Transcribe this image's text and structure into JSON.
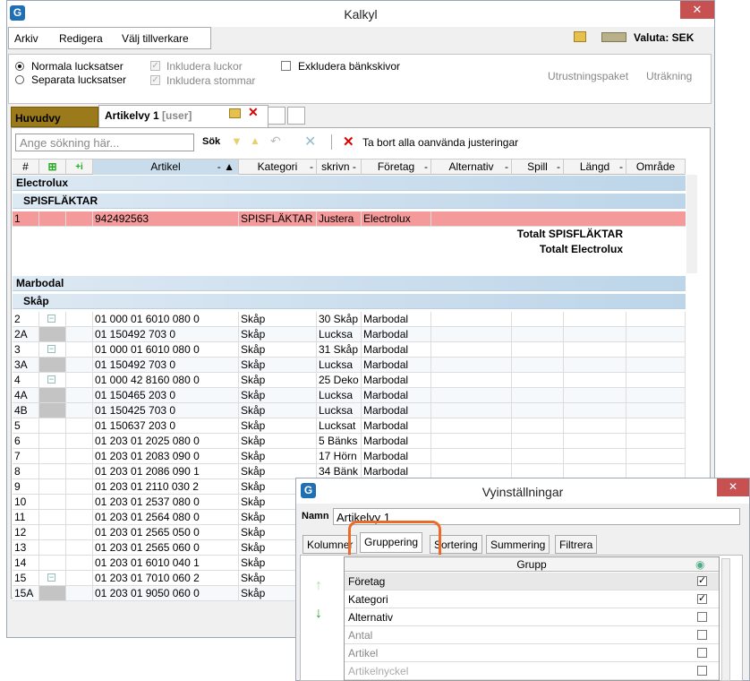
{
  "window": {
    "title": "Kalkyl",
    "close": "✕"
  },
  "menu": {
    "items": [
      "Arkiv",
      "Redigera",
      "Välj tillverkare"
    ],
    "valuta": "Valuta: SEK"
  },
  "options": {
    "normal": "Normala lucksatser",
    "separate": "Separata lucksatser",
    "incl_doors": "Inkludera luckor",
    "incl_frames": "Inkludera stommar",
    "excl_bench": "Exkludera bänkskivor",
    "equip": "Utrustningspaket",
    "calc": "Uträkning"
  },
  "tabs": {
    "main": "Huvudvy",
    "view": "Artikelvy 1",
    "view_user": "[user]"
  },
  "toolbar": {
    "search_placeholder": "Ange sökning här...",
    "search_btn": "Sök",
    "remove_unused": "Ta bort alla oanvända justeringar"
  },
  "columns": [
    "#",
    "",
    "",
    "Artikel",
    "Kategori",
    "skrivn",
    "Företag",
    "Alternativ",
    "Spill",
    "Längd",
    "Område"
  ],
  "groups": {
    "electrolux": "Electrolux",
    "spisflaktar": "SPISFLÄKTAR",
    "total_spis": "Totalt SPISFLÄKTAR",
    "total_electrolux": "Totalt Electrolux",
    "marbodal": "Marbodal",
    "skap": "Skåp"
  },
  "rows": [
    {
      "n": "2",
      "art": "01 000 01 6010 080 0",
      "kat": "Skåp",
      "desc": "30 Skåp",
      "fo": "Marbodal"
    },
    {
      "n": "2A",
      "art": "01 150492 703 0",
      "kat": "Skåp",
      "desc": "Lucksa",
      "fo": "Marbodal"
    },
    {
      "n": "3",
      "art": "01 000 01 6010 080 0",
      "kat": "Skåp",
      "desc": "31 Skåp",
      "fo": "Marbodal"
    },
    {
      "n": "3A",
      "art": "01 150492 703 0",
      "kat": "Skåp",
      "desc": "Lucksa",
      "fo": "Marbodal"
    },
    {
      "n": "4",
      "art": "01 000 42 8160 080 0",
      "kat": "Skåp",
      "desc": "25 Deko",
      "fo": "Marbodal"
    },
    {
      "n": "4A",
      "art": "01 150465 203 0",
      "kat": "Skåp",
      "desc": "Lucksa",
      "fo": "Marbodal"
    },
    {
      "n": "4B",
      "art": "01 150425 703 0",
      "kat": "Skåp",
      "desc": "Lucksa",
      "fo": "Marbodal"
    },
    {
      "n": "5",
      "art": "01 150637 203 0",
      "kat": "Skåp",
      "desc": "Lucksat",
      "fo": "Marbodal"
    },
    {
      "n": "6",
      "art": "01 203 01 2025 080 0",
      "kat": "Skåp",
      "desc": "5 Bänks",
      "fo": "Marbodal"
    },
    {
      "n": "7",
      "art": "01 203 01 2083 090 0",
      "kat": "Skåp",
      "desc": "17 Hörn",
      "fo": "Marbodal"
    },
    {
      "n": "8",
      "art": "01 203 01 2086 090 1",
      "kat": "Skåp",
      "desc": "34 Bänk",
      "fo": "Marbodal"
    },
    {
      "n": "9",
      "art": "01 203 01 2110 030 2",
      "kat": "Skåp",
      "desc": "",
      "fo": ""
    },
    {
      "n": "10",
      "art": "01 203 01 2537 080 0",
      "kat": "Skåp",
      "desc": "",
      "fo": ""
    },
    {
      "n": "11",
      "art": "01 203 01 2564 080 0",
      "kat": "Skåp",
      "desc": "",
      "fo": ""
    },
    {
      "n": "12",
      "art": "01 203 01 2565 050 0",
      "kat": "Skåp",
      "desc": "",
      "fo": ""
    },
    {
      "n": "13",
      "art": "01 203 01 2565 060 0",
      "kat": "Skåp",
      "desc": "",
      "fo": ""
    },
    {
      "n": "14",
      "art": "01 203 01 6010 040 1",
      "kat": "Skåp",
      "desc": "",
      "fo": ""
    },
    {
      "n": "15",
      "art": "01 203 01 7010 060 2",
      "kat": "Skåp",
      "desc": "",
      "fo": ""
    },
    {
      "n": "15A",
      "art": "01 203 01 9050 060 0",
      "kat": "Skåp",
      "desc": "",
      "fo": ""
    }
  ],
  "spis_row": {
    "n": "1",
    "art": "942492563",
    "kat": "SPISFLÄKTAR",
    "desc": "Justera",
    "fo": "Electrolux"
  },
  "dialog": {
    "title": "Vyinställningar",
    "name_label": "Namn",
    "name_value": "Artikelvy 1",
    "tabs": [
      "Kolumner",
      "Gruppering",
      "Sortering",
      "Summering",
      "Filtrera"
    ],
    "grid_header": "Grupp",
    "items": [
      {
        "label": "Företag",
        "checked": "✓"
      },
      {
        "label": "Kategori",
        "checked": "✓"
      },
      {
        "label": "Alternativ",
        "checked": ""
      },
      {
        "label": "Antal",
        "checked": ""
      },
      {
        "label": "Artikel",
        "checked": ""
      },
      {
        "label": "Artikelnyckel",
        "checked": ""
      }
    ]
  }
}
